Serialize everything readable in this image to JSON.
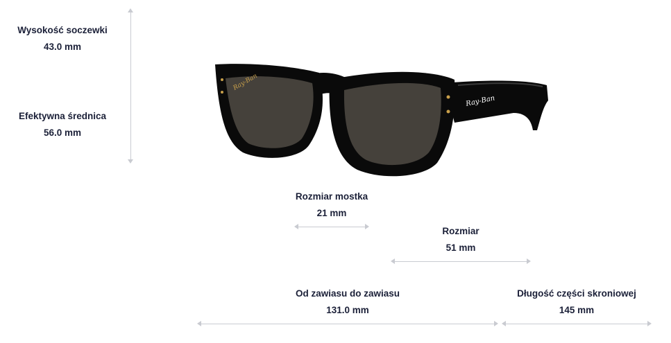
{
  "measurements": {
    "lens_height": {
      "label": "Wysokość soczewki",
      "value": "43.0 mm"
    },
    "effective_diameter": {
      "label": "Efektywna średnica",
      "value": "56.0 mm"
    },
    "bridge_size": {
      "label": "Rozmiar mostka",
      "value": "21 mm"
    },
    "size": {
      "label": "Rozmiar",
      "value": "51 mm"
    },
    "hinge_to_hinge": {
      "label": "Od zawiasu do zawiasu",
      "value": "131.0 mm"
    },
    "temple_length": {
      "label": "Długość części skroniowej",
      "value": "145 mm"
    }
  },
  "product_image": {
    "logo_text": "Ray-Ban",
    "frame_color": "#0a0a0a",
    "lens_color": "#45413b"
  },
  "colors": {
    "text": "#1b2038",
    "arrow": "#c9cbd1"
  }
}
